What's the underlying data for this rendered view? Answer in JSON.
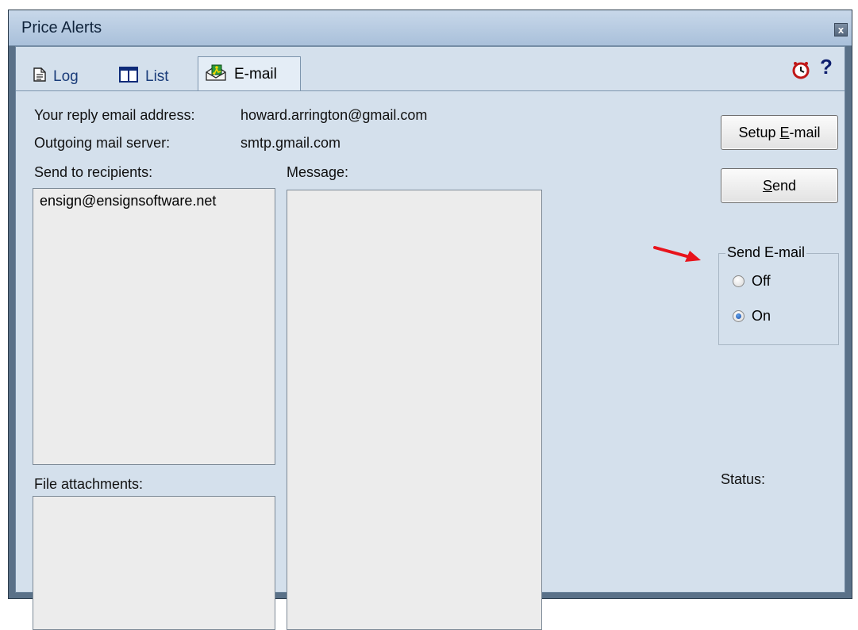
{
  "window": {
    "title": "Price Alerts",
    "close_label": "x"
  },
  "tabs": [
    {
      "label": "Log",
      "icon": "document-icon",
      "active": false
    },
    {
      "label": "List",
      "icon": "columns-icon",
      "active": false
    },
    {
      "label": "E-mail",
      "icon": "email-tab-icon",
      "active": true
    }
  ],
  "toolbar_icons": [
    "clock-icon",
    "help-icon"
  ],
  "help_label": "?",
  "email": {
    "reply_label": "Your reply email address:",
    "reply_value": "howard.arrington@gmail.com",
    "server_label": "Outgoing mail server:",
    "server_value": "smtp.gmail.com",
    "recipients_label": "Send to recipients:",
    "recipients": [
      "ensign@ensignsoftware.net"
    ],
    "message_label": "Message:",
    "attachments_label": "File attachments:",
    "status_label": "Status:"
  },
  "buttons": {
    "setup_prefix": "Setup ",
    "setup_mnemonic": "E",
    "setup_suffix": "-mail",
    "send_mnemonic": "S",
    "send_suffix": "end"
  },
  "send_email_group": {
    "legend": "Send E-mail",
    "options": [
      {
        "label": "Off",
        "checked": false
      },
      {
        "label": "On",
        "checked": true
      }
    ]
  },
  "colors": {
    "panel_bg": "#d4e0ec",
    "frame": "#5a7188",
    "arrow": "#e8141c"
  }
}
